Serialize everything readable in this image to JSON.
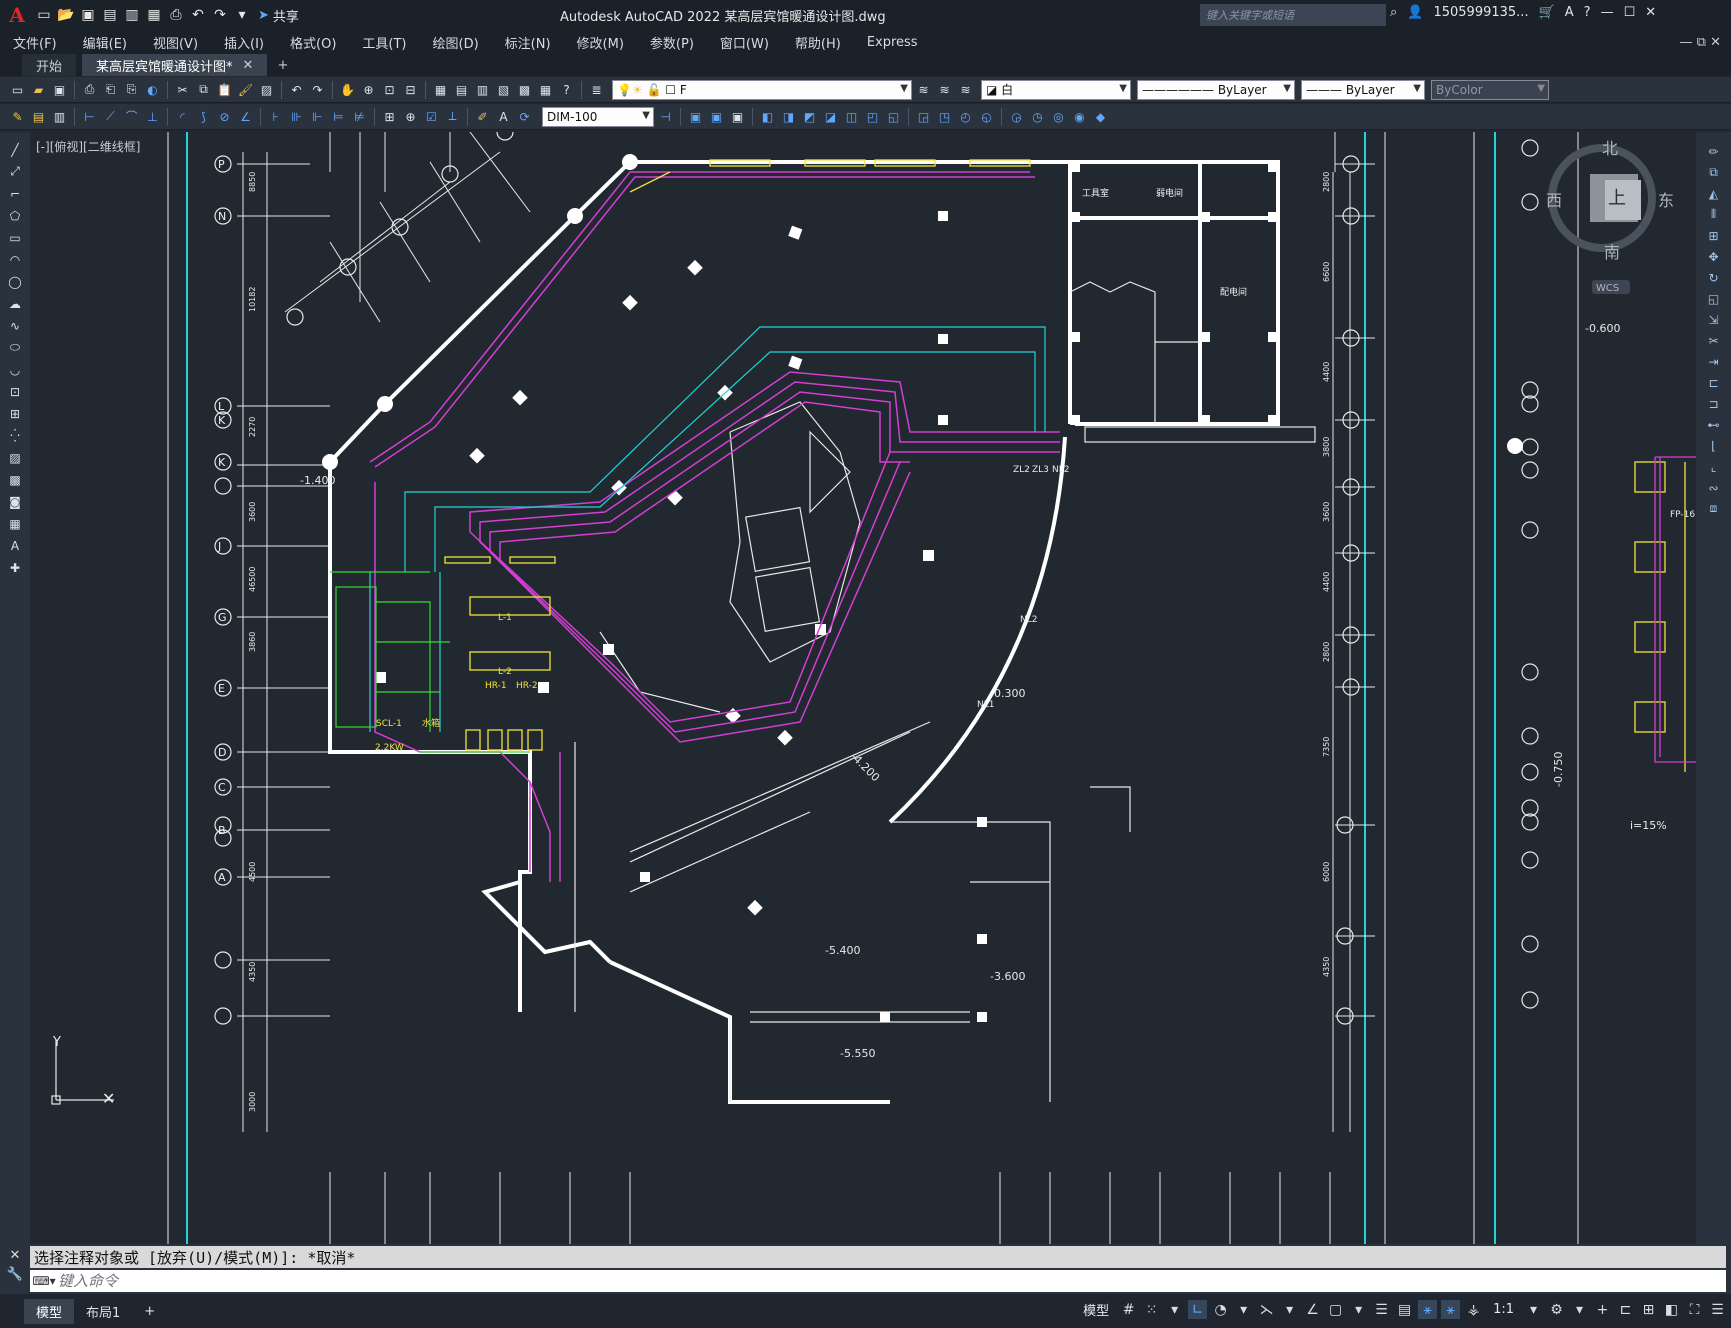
{
  "app": {
    "logo": "A",
    "title": "Autodesk AutoCAD 2022    某高层宾馆暖通设计图.dwg",
    "share_label": "共享",
    "search_placeholder": "键入关键字或短语",
    "user": "1505999135..."
  },
  "menu": [
    "文件(F)",
    "编辑(E)",
    "视图(V)",
    "插入(I)",
    "格式(O)",
    "工具(T)",
    "绘图(D)",
    "标注(N)",
    "修改(M)",
    "参数(P)",
    "窗口(W)",
    "帮助(H)",
    "Express"
  ],
  "tabs": [
    {
      "label": "开始",
      "active": false
    },
    {
      "label": "某高层宾馆暖通设计图*",
      "active": true
    }
  ],
  "toolbar": {
    "layer": "F",
    "color": "白",
    "linetype": "ByLayer",
    "lineweight": "ByLayer",
    "plotstyle": "ByColor",
    "dimstyle": "DIM-100"
  },
  "viewport": {
    "label": "[-][俯视][二维线框]",
    "compass": {
      "n": "北",
      "s": "南",
      "e": "东",
      "w": "西",
      "top": "上",
      "wcs": "WCS"
    },
    "elev_labels": [
      "-1.400",
      "-0.300",
      "-4.200",
      "-5.400",
      "-3.600",
      "-5.550",
      "-0.600",
      "-0.750",
      "i=15%"
    ],
    "room_labels": [
      "工具室",
      "弱电间",
      "配电间",
      "L-1",
      "L-2",
      "HR-1",
      "HR-2",
      "SCL-1",
      "2.2KW",
      "水箱",
      "NL2",
      "NL1",
      "ZL2",
      "ZL3",
      "NL2",
      "FP-16"
    ],
    "grid_left": [
      "P",
      "N",
      "L",
      "K",
      "K",
      "J",
      "G",
      "E",
      "D",
      "C",
      "B",
      "A"
    ],
    "dims_left": [
      "8850",
      "10182",
      "2270",
      "3600",
      "46500",
      "3860",
      "4500",
      "4350",
      "3000"
    ],
    "dims_right": [
      "2800",
      "6600",
      "4400",
      "3800",
      "3600",
      "4400",
      "2800",
      "7350",
      "6000",
      "4350"
    ]
  },
  "command": {
    "history": "选择注释对象或 [放弃(U)/模式(M)]: *取消*",
    "placeholder": "键入命令"
  },
  "status": {
    "layouts": [
      {
        "label": "模型",
        "active": true
      },
      {
        "label": "布局1",
        "active": false
      }
    ],
    "model_label": "模型",
    "scale": "1:1"
  }
}
